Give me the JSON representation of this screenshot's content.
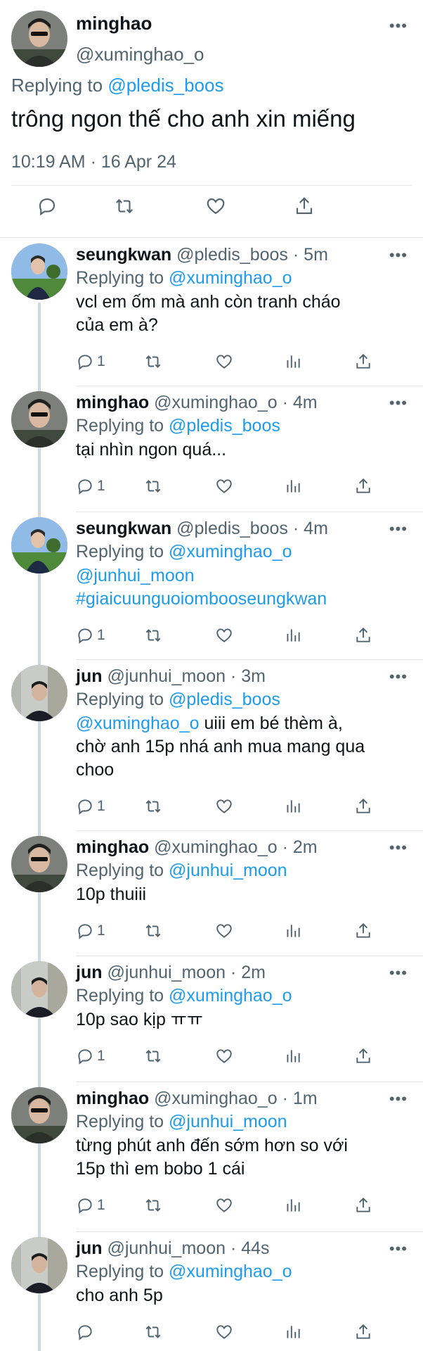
{
  "main_tweet": {
    "author_name": "minghao",
    "author_handle": "@xuminghao_o",
    "replying_prefix": "Replying to",
    "replying_to": "@pledis_boos",
    "text": "trông ngon thế cho anh xin miếng",
    "timestamp": "10:19 AM · 16 Apr 24",
    "more_label": "•••",
    "actions": [
      "reply-icon",
      "retweet-icon",
      "like-icon",
      "share-icon"
    ]
  },
  "replies": [
    {
      "name": "seungkwan",
      "handle": "@pledis_boos",
      "time": "· 5m",
      "replying_to": "@xuminghao_o",
      "lines": [
        "vcl em ốm mà anh còn tranh cháo",
        "của em à?"
      ],
      "reply_count": "1",
      "avatar": "seungkwan"
    },
    {
      "name": "minghao",
      "handle": "@xuminghao_o",
      "time": "· 4m",
      "replying_to": "@pledis_boos",
      "lines": [
        "tại nhìn ngon quá..."
      ],
      "reply_count": "1",
      "avatar": "minghao"
    },
    {
      "name": "seungkwan",
      "handle": "@pledis_boos",
      "time": "· 4m",
      "replying_to": "@xuminghao_o",
      "lines": [
        "@junhui_moon",
        "#giaicuunguoiombooseungkwan"
      ],
      "reply_count": "1",
      "avatar": "seungkwan"
    },
    {
      "name": "jun",
      "handle": "@junhui_moon",
      "time": "· 3m",
      "replying_to": "@pledis_boos",
      "mention": "@xuminghao_o",
      "lines": [
        " uiii em bé thèm à,",
        "chờ anh 15p nhá anh mua mang qua",
        "choo"
      ],
      "reply_count": "1",
      "avatar": "jun"
    },
    {
      "name": "minghao",
      "handle": "@xuminghao_o",
      "time": "· 2m",
      "replying_to": "@junhui_moon",
      "lines": [
        "10p thuiii"
      ],
      "reply_count": "1",
      "avatar": "minghao"
    },
    {
      "name": "jun",
      "handle": "@junhui_moon",
      "time": "· 2m",
      "replying_to": "@xuminghao_o",
      "lines": [
        "10p sao kịp ㅠㅠ"
      ],
      "reply_count": "1",
      "avatar": "jun"
    },
    {
      "name": "minghao",
      "handle": "@xuminghao_o",
      "time": "· 1m",
      "replying_to": "@junhui_moon",
      "lines": [
        "từng phút anh đến sớm hơn so với",
        "15p thì em bobo 1 cái"
      ],
      "reply_count": "1",
      "avatar": "minghao"
    },
    {
      "name": "jun",
      "handle": "@junhui_moon",
      "time": "· 44s",
      "replying_to": "@xuminghao_o",
      "lines": [
        "cho anh 5p"
      ],
      "reply_count": "",
      "avatar": "jun"
    }
  ],
  "colors": {
    "link": "#1d9bf0",
    "muted": "#536471",
    "text": "#0f1419",
    "divider": "#e6e6e6"
  }
}
